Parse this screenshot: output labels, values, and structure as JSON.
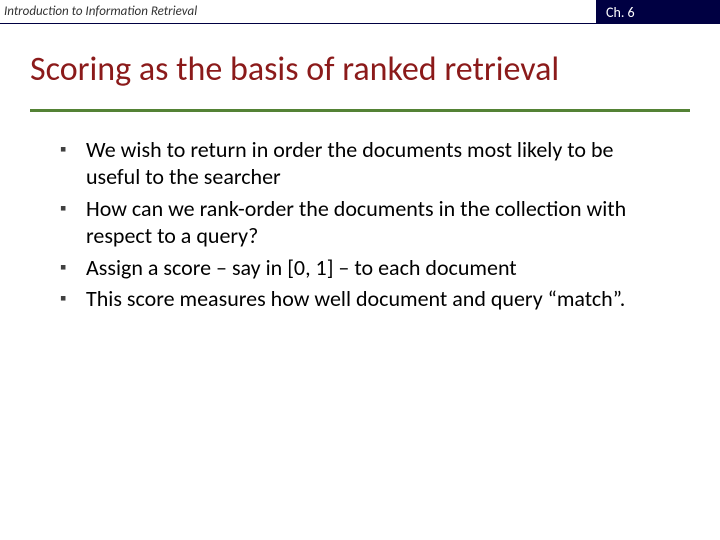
{
  "header": {
    "course": "Introduction to Information Retrieval",
    "chapter": "Ch. 6"
  },
  "title": "Scoring as the basis of ranked retrieval",
  "bullets": [
    "We wish to return in order the documents most likely to be useful to the searcher",
    "How can we rank-order the documents in the collection with respect to a query?",
    "Assign a score – say in [0, 1] – to each document",
    "This score measures how well document and query “match”."
  ]
}
